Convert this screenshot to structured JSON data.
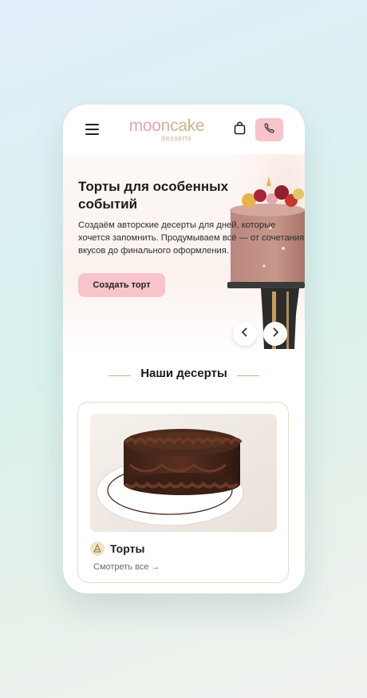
{
  "brand": {
    "logo_main_1": "moon",
    "logo_main_2": "cake",
    "logo_sub": "desserts",
    "pink": "#f8c3cb",
    "gold": "#c9b58a"
  },
  "header": {
    "menu_icon": "burger-menu-icon",
    "cart_icon": "shopping-bag-icon",
    "phone_icon": "phone-icon"
  },
  "hero": {
    "title": "Торты для особенных событий",
    "text": "Создаём авторские десерты для дней, которые хочется запомнить. Продумываем всё — от сочетания вкусов до финального оформления.",
    "cta_label": "Создать торт",
    "prev_icon": "chevron-left-icon",
    "next_icon": "chevron-right-icon"
  },
  "desserts": {
    "section_title": "Наши десерты",
    "card": {
      "title": "Торты",
      "link": "Смотреть все →",
      "icon": "cake-icon"
    }
  }
}
